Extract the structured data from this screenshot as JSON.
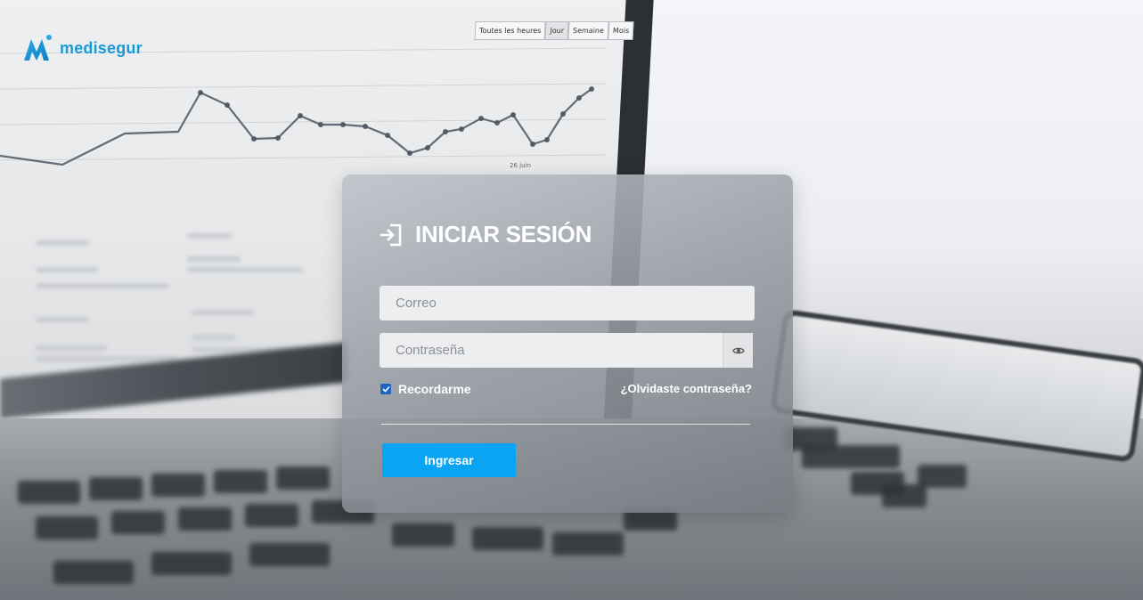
{
  "brand": {
    "name": "medisegur",
    "color": "#1a9ad6"
  },
  "background_chart": {
    "toolbar": [
      "Toutes les heures",
      "Jour",
      "Semaine",
      "Mois"
    ],
    "active_range": "Jour",
    "axis_label": "26 juin"
  },
  "login": {
    "title": "INICIAR SESIÓN",
    "title_icon": "login-icon",
    "email_placeholder": "Correo",
    "password_placeholder": "Contraseña",
    "password_toggle_icon": "eye-icon",
    "remember_label": "Recordarme",
    "remember_checked": true,
    "forgot_label": "¿Olvidaste contraseña?",
    "submit_label": "Ingresar",
    "accent_color": "#0aa5f2"
  }
}
